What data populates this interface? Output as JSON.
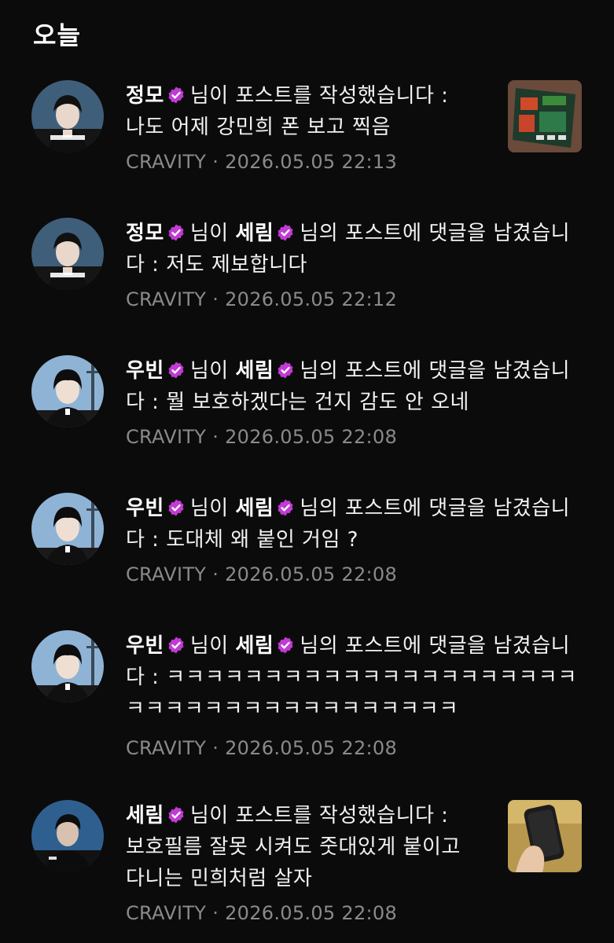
{
  "section": {
    "title": "오늘"
  },
  "notifications": [
    {
      "actor": "정모",
      "pre": "님이 포스트를 작성했습니다 :",
      "body": "나도 어제 강민희 폰 보고 찍음",
      "group": "CRAVITY",
      "sep": " · ",
      "time": "2026.05.05 22:13",
      "avatar_icon": "jungmo-avatar",
      "thumbnail": "photo-thumbnail"
    },
    {
      "actor": "정모",
      "mid": "님이",
      "target": "세림",
      "pre": "님의 포스트에 댓글을 남겼습니다 :",
      "body": "저도 제보합니다",
      "group": "CRAVITY",
      "sep": " · ",
      "time": "2026.05.05 22:12",
      "avatar_icon": "jungmo-avatar"
    },
    {
      "actor": "우빈",
      "mid": "님이",
      "target": "세림",
      "pre": "님의 포스트에 댓글을 남겼습니다 :",
      "body": "뭘 보호하겠다는 건지 감도 안 오네",
      "group": "CRAVITY",
      "sep": " · ",
      "time": "2026.05.05 22:08",
      "avatar_icon": "woobin-avatar"
    },
    {
      "actor": "우빈",
      "mid": "님이",
      "target": "세림",
      "pre": "님의 포스트에 댓글을 남겼습니다 :",
      "body": "도대체 왜 붙인 거임 ?",
      "group": "CRAVITY",
      "sep": " · ",
      "time": "2026.05.05 22:08",
      "avatar_icon": "woobin-avatar"
    },
    {
      "actor": "우빈",
      "mid": "님이",
      "target": "세림",
      "pre": "님의 포스트에 댓글을 남겼습니다 :",
      "body": "ㅋㅋㅋㅋㅋㅋㅋㅋㅋㅋㅋㅋㅋㅋㅋㅋㅋㅋㅋㅋㅋㅋㅋㅋㅋㅋㅋㅋㅋㅋㅋㅋㅋㅋㅋㅋㅋㅋ",
      "group": "CRAVITY",
      "sep": " · ",
      "time": "2026.05.05 22:08",
      "avatar_icon": "woobin-avatar"
    },
    {
      "actor": "세림",
      "pre": "님이 포스트를 작성했습니다 :",
      "body": "보호필름 잘못 시켜도 줏대있게 붙이고 다니는 민희처럼 살자",
      "group": "CRAVITY",
      "sep": " · ",
      "time": "2026.05.05 22:08",
      "avatar_icon": "serim-avatar",
      "thumbnail": "phone-photo-thumbnail"
    }
  ],
  "colors": {
    "background": "#0b0b0b",
    "badge": "#c23bd4",
    "meta_text": "#8a8a8a",
    "text": "#f2f2f2"
  },
  "badge_icon": "verified-badge-icon"
}
